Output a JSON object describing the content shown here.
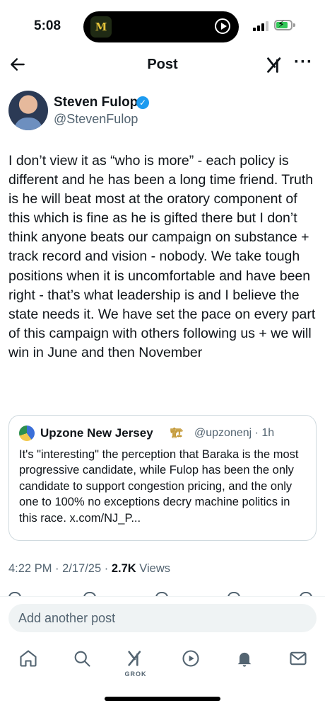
{
  "status_bar": {
    "time": "5:08",
    "app_thumb_letter": "M"
  },
  "header": {
    "title": "Post"
  },
  "author": {
    "name": "Steven Fulop",
    "handle": "@StevenFulop"
  },
  "post": {
    "text": "I don’t view it as “who is more” - each policy is different and he has been a long time friend. Truth is he will beat most at the oratory component of this which is fine as he is gifted there but I don’t think anyone beats our campaign on substance + track record and vision - nobody. We take tough positions when it is uncomfortable and have been right - that’s what leadership is and I believe the state needs it. We have set the pace on every part of this campaign with others following us + we will win in June and then November"
  },
  "quote": {
    "name": "Upzone New Jersey",
    "name_emoji": "🏗",
    "handle_time": "@upzonenj · 1h",
    "text": "It's \"interesting\" the perception that Baraka is the most progressive candidate, while Fulop has been the only candidate to support congestion pricing, and the only one to 100% no exceptions decry machine politics in this race. x.com/NJ_P..."
  },
  "meta": {
    "time": "4:22 PM · 2/17/25 · ",
    "views_count": "2.7K",
    "views_label": " Views"
  },
  "compose": {
    "placeholder": "Add another post"
  },
  "tabbar": {
    "grok_label": "GROK"
  },
  "colors": {
    "verified": "#1d9bf0",
    "secondary_text": "#536471",
    "compose_bg": "#eff3f4"
  }
}
